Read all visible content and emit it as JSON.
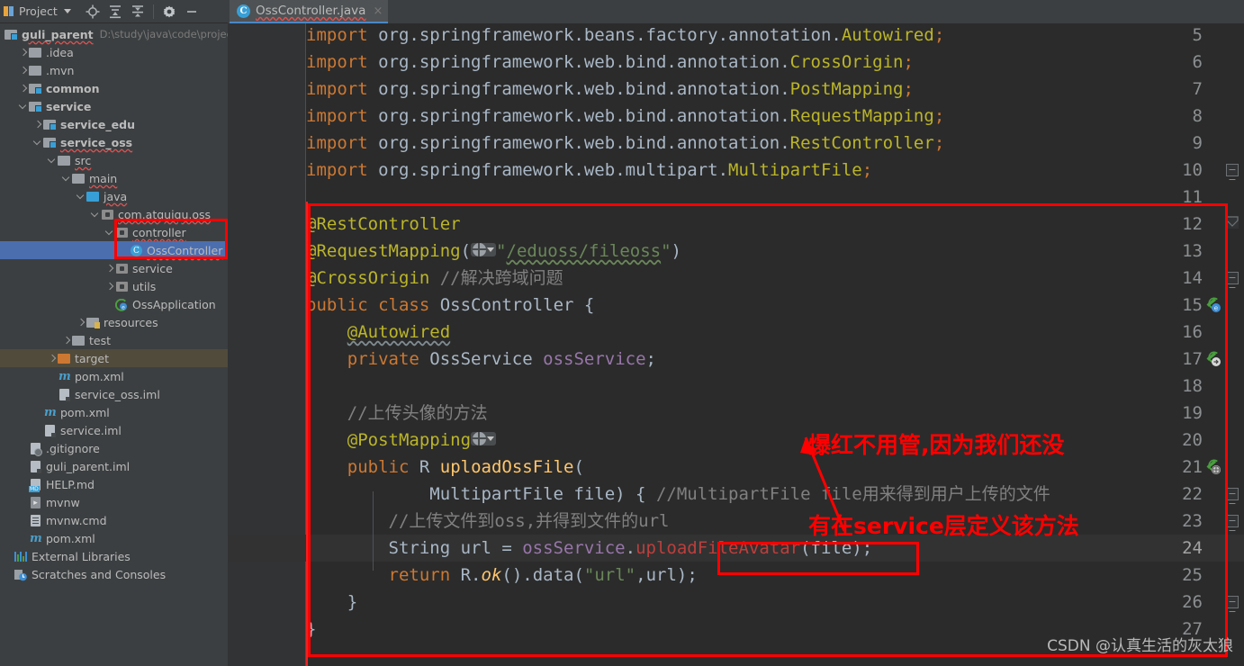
{
  "window": {
    "panel_title": "Project",
    "toolbar_icons": [
      "locate-icon",
      "expand-all-icon",
      "collapse-all-icon",
      "settings-gear-icon",
      "hide-panel-icon"
    ]
  },
  "tab": {
    "filename": "OssController.java",
    "icon": "java-class-icon",
    "icon_letter": "C",
    "close": "×"
  },
  "tree": {
    "root": {
      "label": "guli_parent",
      "path": "D:\\study\\java\\code\\projec"
    },
    "items": [
      {
        "label": ".idea",
        "indent": 1,
        "arrow": "right",
        "icon": "folder-plain-icon"
      },
      {
        "label": ".mvn",
        "indent": 1,
        "arrow": "right",
        "icon": "folder-plain-icon"
      },
      {
        "label": "common",
        "indent": 1,
        "arrow": "right",
        "icon": "folder-module-icon",
        "bold": true
      },
      {
        "label": "service",
        "indent": 1,
        "arrow": "down",
        "icon": "folder-module-icon",
        "bold": true
      },
      {
        "label": "service_edu",
        "indent": 2,
        "arrow": "right",
        "icon": "folder-module-icon",
        "bold": true
      },
      {
        "label": "service_oss",
        "indent": 2,
        "arrow": "down",
        "icon": "folder-module-icon",
        "bold": true,
        "wavy": true
      },
      {
        "label": "src",
        "indent": 3,
        "arrow": "down",
        "icon": "folder-plain-icon",
        "wavy": true
      },
      {
        "label": "main",
        "indent": 4,
        "arrow": "down",
        "icon": "folder-plain-icon",
        "wavy": true
      },
      {
        "label": "java",
        "indent": 5,
        "arrow": "down",
        "icon": "folder-source-icon",
        "wavy": true
      },
      {
        "label": "com.atquiqu.oss",
        "indent": 6,
        "arrow": "down",
        "icon": "package-icon",
        "wavy": true
      },
      {
        "label": "controller",
        "indent": 7,
        "arrow": "down",
        "icon": "package-icon",
        "wavy": true
      },
      {
        "label": "OssController",
        "indent": 8,
        "arrow": "none",
        "icon": "java-class-icon",
        "selected": true,
        "wavy": true
      },
      {
        "label": "service",
        "indent": 7,
        "arrow": "right",
        "icon": "package-icon"
      },
      {
        "label": "utils",
        "indent": 7,
        "arrow": "right",
        "icon": "package-icon"
      },
      {
        "label": "OssApplication",
        "indent": 7,
        "arrow": "none",
        "icon": "spring-boot-icon"
      },
      {
        "label": "resources",
        "indent": 5,
        "arrow": "right",
        "icon": "folder-resources-icon"
      },
      {
        "label": "test",
        "indent": 4,
        "arrow": "right",
        "icon": "folder-plain-icon"
      },
      {
        "label": "target",
        "indent": 3,
        "arrow": "right",
        "icon": "folder-target-icon",
        "target": true
      },
      {
        "label": "pom.xml",
        "indent": 3,
        "arrow": "none",
        "icon": "maven-icon"
      },
      {
        "label": "service_oss.iml",
        "indent": 3,
        "arrow": "none",
        "icon": "iml-file-icon"
      },
      {
        "label": "pom.xml",
        "indent": 2,
        "arrow": "none",
        "icon": "maven-icon"
      },
      {
        "label": "service.iml",
        "indent": 2,
        "arrow": "none",
        "icon": "iml-file-icon"
      },
      {
        "label": ".gitignore",
        "indent": 1,
        "arrow": "none",
        "icon": "gitignore-icon"
      },
      {
        "label": "guli_parent.iml",
        "indent": 1,
        "arrow": "none",
        "icon": "iml-file-icon"
      },
      {
        "label": "HELP.md",
        "indent": 1,
        "arrow": "none",
        "icon": "markdown-icon"
      },
      {
        "label": "mvnw",
        "indent": 1,
        "arrow": "none",
        "icon": "shell-script-icon"
      },
      {
        "label": "mvnw.cmd",
        "indent": 1,
        "arrow": "none",
        "icon": "cmd-file-icon"
      },
      {
        "label": "pom.xml",
        "indent": 1,
        "arrow": "none",
        "icon": "maven-icon"
      },
      {
        "label": "External Libraries",
        "indent": 0,
        "arrow": "none",
        "icon": "libraries-icon"
      },
      {
        "label": "Scratches and Consoles",
        "indent": 0,
        "arrow": "none",
        "icon": "scratches-icon"
      }
    ]
  },
  "editor": {
    "current_line": 24,
    "lines": [
      {
        "num": 5,
        "text": "import org.springframework.beans.factory.annotation.Autowired;"
      },
      {
        "num": 6,
        "text": "import org.springframework.web.bind.annotation.CrossOrigin;"
      },
      {
        "num": 7,
        "text": "import org.springframework.web.bind.annotation.PostMapping;"
      },
      {
        "num": 8,
        "text": "import org.springframework.web.bind.annotation.RequestMapping;"
      },
      {
        "num": 9,
        "text": "import org.springframework.web.bind.annotation.RestController;"
      },
      {
        "num": 10,
        "text": "import org.springframework.web.multipart.MultipartFile;"
      },
      {
        "num": 11,
        "text": ""
      },
      {
        "num": 12,
        "text": "@RestController"
      },
      {
        "num": 13,
        "text": "@RequestMapping(\"/eduoss/fileoss\")"
      },
      {
        "num": 14,
        "text": "@CrossOrigin //解决跨域问题"
      },
      {
        "num": 15,
        "text": "public class OssController {"
      },
      {
        "num": 16,
        "text": "    @Autowired"
      },
      {
        "num": 17,
        "text": "    private OssService ossService;"
      },
      {
        "num": 18,
        "text": ""
      },
      {
        "num": 19,
        "text": "    //上传头像的方法"
      },
      {
        "num": 20,
        "text": "    @PostMapping"
      },
      {
        "num": 21,
        "text": "    public R uploadOssFile("
      },
      {
        "num": 22,
        "text": "            MultipartFile file) { //MultipartFile file用来得到用户上传的文件"
      },
      {
        "num": 23,
        "text": "        //上传文件到oss,并得到文件的url"
      },
      {
        "num": 24,
        "text": "        String url = ossService.uploadFileAvatar(file);"
      },
      {
        "num": 25,
        "text": "        return R.ok().data(\"url\",url);"
      },
      {
        "num": 26,
        "text": "    }"
      },
      {
        "num": 27,
        "text": "}"
      }
    ]
  },
  "annotations": {
    "note_line1": "爆红不用管,因为我们还没",
    "note_line2": "有在service层定义该方法",
    "color": "#ff0000",
    "boxes": [
      "tree-osscontroller-box",
      "code-block-box",
      "uploadFileAvatar-box"
    ],
    "arrow": "red-arrow-pointing-to-uploadFileAvatar"
  },
  "watermark": {
    "text": "CSDN @认真生活的灰太狼"
  }
}
